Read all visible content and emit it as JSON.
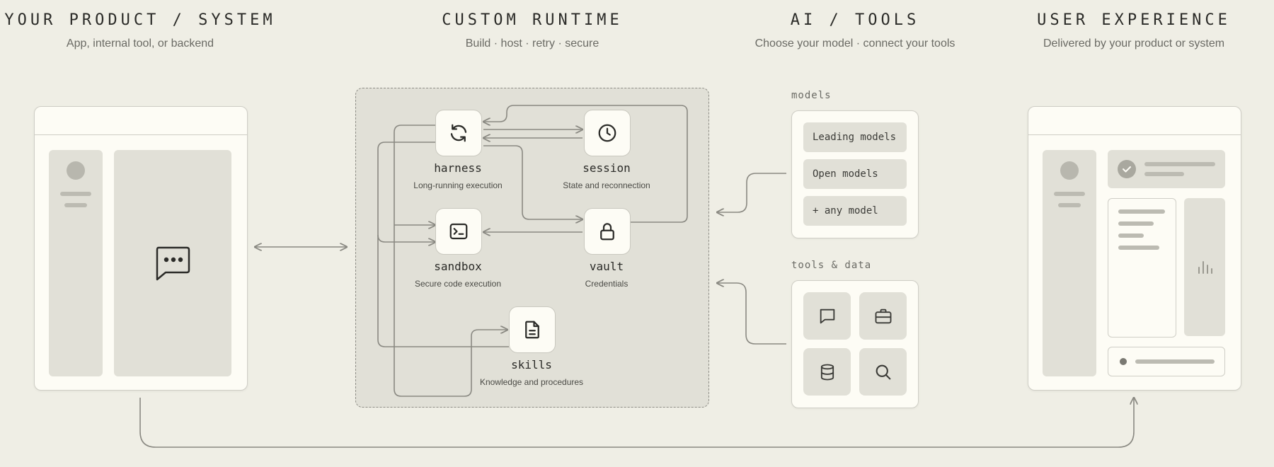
{
  "columns": [
    {
      "title": "YOUR PRODUCT / SYSTEM",
      "subtitle": "App, internal tool, or backend"
    },
    {
      "title": "CUSTOM RUNTIME",
      "subtitle": "Build · host · retry · secure"
    },
    {
      "title": "AI / TOOLS",
      "subtitle": "Choose your model · connect your tools"
    },
    {
      "title": "USER EXPERIENCE",
      "subtitle": "Delivered by your product or system"
    }
  ],
  "runtime": {
    "nodes": [
      {
        "label": "harness",
        "description": "Long-running execution",
        "icon": "refresh-icon"
      },
      {
        "label": "session",
        "description": "State and reconnection",
        "icon": "clock-icon"
      },
      {
        "label": "sandbox",
        "description": "Secure code execution",
        "icon": "terminal-icon"
      },
      {
        "label": "vault",
        "description": "Credentials",
        "icon": "lock-icon"
      },
      {
        "label": "skills",
        "description": "Knowledge and procedures",
        "icon": "document-icon"
      }
    ]
  },
  "models": {
    "label": "models",
    "items": [
      "Leading models",
      "Open models",
      "+ any model"
    ]
  },
  "tools": {
    "label": "tools & data",
    "icons": [
      "chat-icon",
      "briefcase-icon",
      "database-icon",
      "search-icon"
    ]
  },
  "colors": {
    "background": "#efeee5",
    "panel": "#e1e0d7",
    "card": "#fdfcf5",
    "wire": "#8a8982",
    "text": "#2b2b28"
  }
}
